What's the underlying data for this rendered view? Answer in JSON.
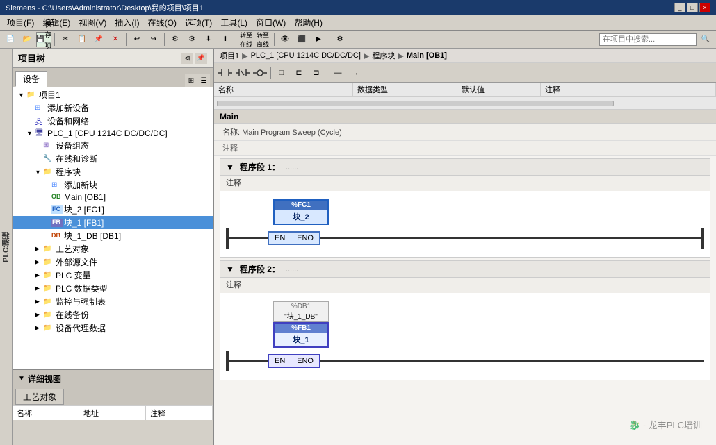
{
  "titlebar": {
    "text": "Siemens - C:\\Users\\Administrator\\Desktop\\我的项目\\项目1",
    "buttons": [
      "_",
      "□",
      "×"
    ]
  },
  "menubar": {
    "items": [
      "项目(F)",
      "编辑(E)",
      "视图(V)",
      "插入(I)",
      "在线(O)",
      "选项(T)",
      "工具(L)",
      "窗口(W)",
      "帮助(H)"
    ]
  },
  "toolbar": {
    "search_placeholder": "在项目中搜索...",
    "save_label": "保存项目"
  },
  "breadcrumb": {
    "items": [
      "项目1",
      "PLC_1 [CPU 1214C DC/DC/DC]",
      "程序块",
      "Main [OB1]"
    ],
    "separator": "▶"
  },
  "project_tree": {
    "title": "项目树",
    "tab": "设备",
    "items": [
      {
        "label": "项目1",
        "level": 0,
        "expanded": true,
        "icon": "project"
      },
      {
        "label": "添加新设备",
        "level": 1,
        "icon": "add"
      },
      {
        "label": "设备和网络",
        "level": 1,
        "icon": "network"
      },
      {
        "label": "PLC_1 [CPU 1214C DC/DC/DC]",
        "level": 1,
        "expanded": true,
        "icon": "plc"
      },
      {
        "label": "设备组态",
        "level": 2,
        "icon": "device"
      },
      {
        "label": "在线和诊断",
        "level": 2,
        "icon": "diag"
      },
      {
        "label": "程序块",
        "level": 2,
        "expanded": true,
        "icon": "folder"
      },
      {
        "label": "添加新块",
        "level": 3,
        "icon": "add"
      },
      {
        "label": "Main [OB1]",
        "level": 3,
        "icon": "ob"
      },
      {
        "label": "块_2 [FC1]",
        "level": 3,
        "icon": "fc"
      },
      {
        "label": "块_1 [FB1]",
        "level": 3,
        "icon": "fb",
        "selected": true
      },
      {
        "label": "块_1_DB [DB1]",
        "level": 3,
        "icon": "db"
      },
      {
        "label": "工艺对象",
        "level": 2,
        "expanded": false,
        "icon": "folder"
      },
      {
        "label": "外部源文件",
        "level": 2,
        "expanded": false,
        "icon": "folder"
      },
      {
        "label": "PLC 变量",
        "level": 2,
        "expanded": false,
        "icon": "folder"
      },
      {
        "label": "PLC 数据类型",
        "level": 2,
        "expanded": false,
        "icon": "folder"
      },
      {
        "label": "监控与强制表",
        "level": 2,
        "expanded": false,
        "icon": "folder"
      },
      {
        "label": "在线备份",
        "level": 2,
        "expanded": false,
        "icon": "folder"
      },
      {
        "label": "设备代理数据",
        "level": 2,
        "expanded": false,
        "icon": "folder"
      }
    ]
  },
  "detail_view": {
    "title": "详细视图",
    "tab": "工艺对象",
    "columns": [
      "名称",
      "地址",
      "注释"
    ]
  },
  "editor": {
    "title": "Main",
    "var_columns": [
      "名称",
      "数据类型",
      "默认值",
      "注释"
    ],
    "segments": [
      {
        "title": "程序段 1：",
        "dots": "......",
        "comment": "注释",
        "type": "fc_call",
        "fc_name": "%FC1",
        "fc_label": "块_2",
        "en_label": "EN",
        "eno_label": "ENO"
      },
      {
        "title": "程序段 2：",
        "dots": "......",
        "comment": "注释",
        "type": "fb_call",
        "db_ref": "%DB1",
        "db_name": "块_1_DB",
        "fb_name": "%FB1",
        "fb_label": "块_1",
        "en_label": "EN",
        "eno_label": "ENO"
      }
    ],
    "cycle_comment": "名称:    Main Program Sweep (Cycle)"
  },
  "watermark": "龙丰PLC培训",
  "plc_label": "PLC编程"
}
